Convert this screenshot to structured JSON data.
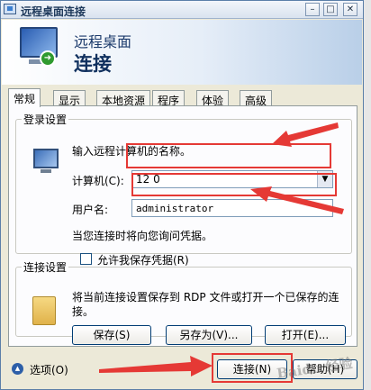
{
  "window": {
    "title": "远程桌面连接",
    "controls": {
      "minimize": "–",
      "maximize": "□",
      "close": "✕"
    }
  },
  "header": {
    "line1": "远程桌面",
    "line2": "连接"
  },
  "tabs": [
    {
      "label": "常规",
      "active": true
    },
    {
      "label": "显示",
      "active": false
    },
    {
      "label": "本地资源",
      "active": false
    },
    {
      "label": "程序",
      "active": false
    },
    {
      "label": "体验",
      "active": false
    },
    {
      "label": "高级",
      "active": false
    }
  ],
  "login": {
    "legend": "登录设置",
    "prompt": "输入远程计算机的名称。",
    "computer_label": "计算机(C):",
    "computer_value": "12          0",
    "username_label": "用户名:",
    "username_value": "administrator",
    "note": "当您连接时将向您询问凭据。",
    "save_cred_label": "允许我保存凭据(R)",
    "save_cred_checked": false
  },
  "connection": {
    "legend": "连接设置",
    "description": "将当前连接设置保存到 RDP 文件或打开一个已保存的连接。",
    "save_button": "保存(S)",
    "save_as_button": "另存为(V)...",
    "open_button": "打开(E)..."
  },
  "footer": {
    "options_label": "选项(O)",
    "connect_button": "连接(N)",
    "help_button": "帮助(H)"
  },
  "colors": {
    "annotation": "#e53935",
    "accent": "#1b3a6b"
  },
  "icons": {
    "app": "remote-desktop-icon",
    "computer": "computer-icon",
    "folder": "folder-icon"
  }
}
